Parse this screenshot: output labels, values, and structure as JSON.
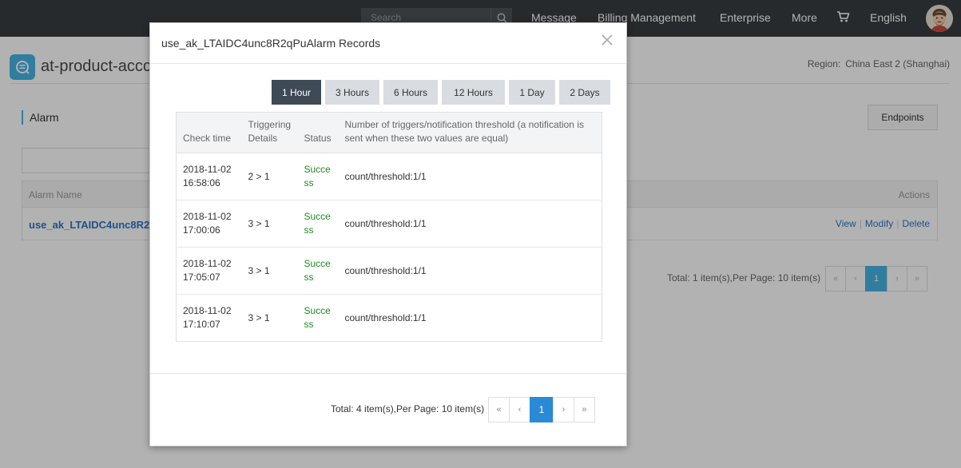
{
  "topbar": {
    "search_placeholder": "Search",
    "nav": [
      "Message",
      "Billing Management",
      "Enterprise",
      "More",
      "English"
    ]
  },
  "page": {
    "app_title": "at-product-acco",
    "region_label": "Region:",
    "region_value": "China East 2 (Shanghai)",
    "section_title": "Alarm",
    "endpoints_label": "Endpoints",
    "list_headers": {
      "name": "Alarm Name",
      "actions": "Actions"
    },
    "row": {
      "name": "use_ak_LTAIDC4unc8R2qPuAlarm",
      "actions": [
        "View",
        "Modify",
        "Delete"
      ]
    },
    "total_text": "Total: 1 item(s),Per Page: 10 item(s)",
    "pager": [
      "«",
      "‹",
      "1",
      "›",
      "»"
    ]
  },
  "modal": {
    "title": "use_ak_LTAIDC4unc8R2qPuAlarm Records",
    "tabs": [
      "1 Hour",
      "3 Hours",
      "6 Hours",
      "12 Hours",
      "1 Day",
      "2 Days"
    ],
    "active_tab": "1 Hour",
    "columns": [
      "Check time",
      "Triggering Details",
      "Status",
      "Number of triggers/notification threshold (a notification is sent when these two values are equal)"
    ],
    "rows": [
      {
        "date": "2018-11-02",
        "time": "16:58:06",
        "detail": "2 > 1",
        "status": "Success",
        "count": "count/threshold:1/1"
      },
      {
        "date": "2018-11-02",
        "time": "17:00:06",
        "detail": "3 > 1",
        "status": "Success",
        "count": "count/threshold:1/1"
      },
      {
        "date": "2018-11-02",
        "time": "17:05:07",
        "detail": "3 > 1",
        "status": "Success",
        "count": "count/threshold:1/1"
      },
      {
        "date": "2018-11-02",
        "time": "17:10:07",
        "detail": "3 > 1",
        "status": "Success",
        "count": "count/threshold:1/1"
      }
    ],
    "total_text": "Total: 4 item(s),Per Page: 10 item(s)",
    "pager": [
      "«",
      "‹",
      "1",
      "›",
      "»"
    ]
  },
  "colors": {
    "topbar": "#373d41",
    "accent": "#46b3e6",
    "active_tab": "#3e4a56",
    "status_success": "#1e8a1e",
    "pager_active": "#2b8ad5"
  }
}
